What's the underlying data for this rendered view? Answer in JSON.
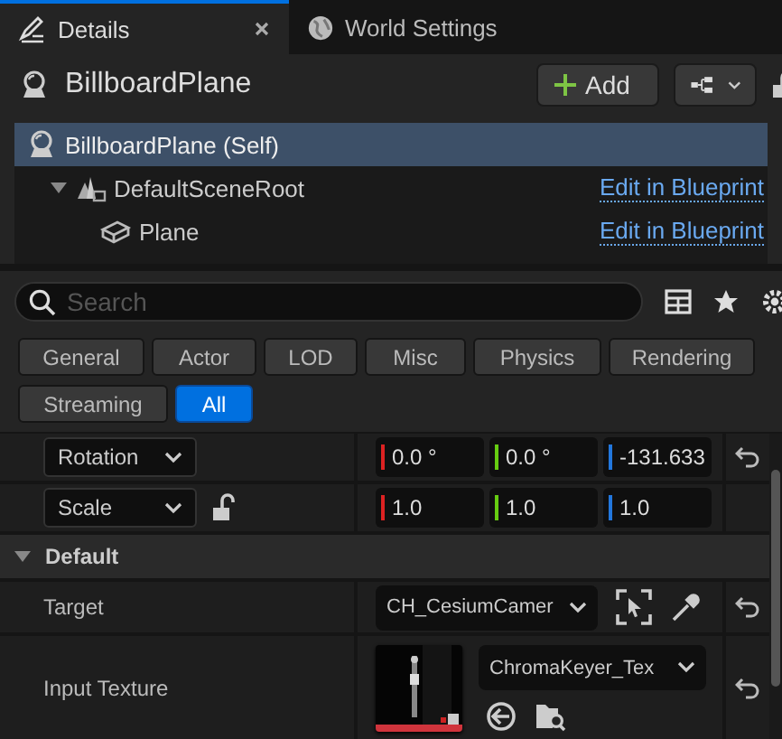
{
  "tabs": [
    {
      "label": "Details",
      "selected": true
    },
    {
      "label": "World Settings",
      "selected": false
    }
  ],
  "header": {
    "title": "BillboardPlane",
    "add_button": "Add",
    "locked": false
  },
  "components": [
    {
      "label": "BillboardPlane (Self)",
      "selected": true,
      "children": [
        {
          "label": "DefaultSceneRoot",
          "selected": false,
          "expanded": true,
          "link": "Edit in Blueprint",
          "children": [
            {
              "label": "Plane",
              "selected": false,
              "link": "Edit in Blueprint"
            }
          ]
        }
      ]
    }
  ],
  "search": {
    "placeholder": "Search"
  },
  "filters": [
    {
      "label": "General",
      "selected": false
    },
    {
      "label": "Actor",
      "selected": false
    },
    {
      "label": "LOD",
      "selected": false
    },
    {
      "label": "Misc",
      "selected": false
    },
    {
      "label": "Physics",
      "selected": false
    },
    {
      "label": "Rendering",
      "selected": false
    },
    {
      "label": "Streaming",
      "selected": false
    },
    {
      "label": "All",
      "selected": true
    }
  ],
  "properties": [
    {
      "kind": "vector",
      "label": "Rotation",
      "values": [
        "0.0 °",
        "0.0 °",
        "-131.633"
      ],
      "resettable": true
    },
    {
      "kind": "vector",
      "label": "Scale",
      "values": [
        "1.0",
        "1.0",
        "1.0"
      ],
      "locked": false,
      "resettable": false
    },
    {
      "kind": "category",
      "label": "Default",
      "expanded": true
    },
    {
      "kind": "object",
      "label": "Target",
      "value": "CH_CesiumCamer",
      "resettable": true
    },
    {
      "kind": "texture",
      "label": "Input Texture",
      "value": "ChromaKeyer_Tex",
      "resettable": true
    }
  ]
}
